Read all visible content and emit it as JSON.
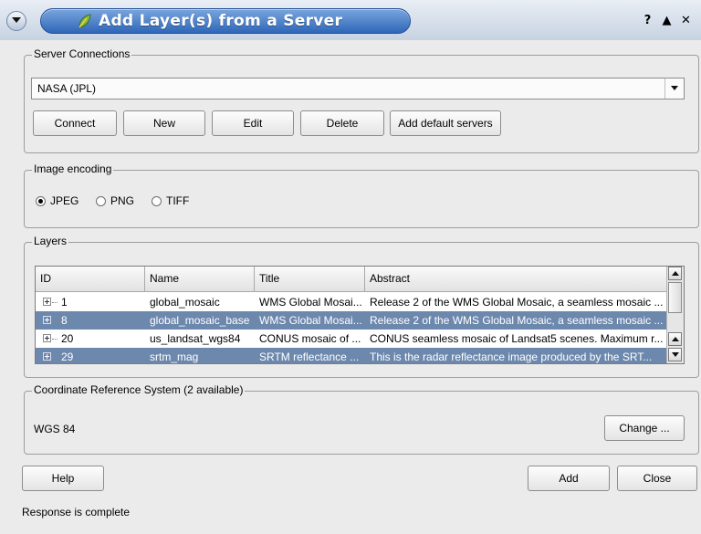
{
  "window": {
    "title": "Add Layer(s) from a Server",
    "controls": [
      "?",
      "▲",
      "✕"
    ]
  },
  "server_connections": {
    "group_title": "Server Connections",
    "selected_server": "NASA (JPL)",
    "buttons": {
      "connect": "Connect",
      "new": "New",
      "edit": "Edit",
      "delete": "Delete",
      "add_default": "Add default servers"
    }
  },
  "image_encoding": {
    "group_title": "Image encoding",
    "options": [
      {
        "label": "JPEG",
        "selected": true
      },
      {
        "label": "PNG",
        "selected": false
      },
      {
        "label": "TIFF",
        "selected": false
      }
    ]
  },
  "layers": {
    "group_title": "Layers",
    "columns": [
      "ID",
      "Name",
      "Title",
      "Abstract"
    ],
    "rows": [
      {
        "id": "1",
        "name": "global_mosaic",
        "title": "WMS Global Mosai...",
        "abstract": "Release 2 of the WMS Global Mosaic, a seamless mosaic ...",
        "selected": false
      },
      {
        "id": "8",
        "name": "global_mosaic_base",
        "title": "WMS Global Mosai...",
        "abstract": "Release 2 of the WMS Global Mosaic, a seamless mosaic ...",
        "selected": true
      },
      {
        "id": "20",
        "name": "us_landsat_wgs84",
        "title": "CONUS mosaic of ...",
        "abstract": "CONUS seamless mosaic of Landsat5 scenes. Maximum r...",
        "selected": false
      },
      {
        "id": "29",
        "name": "srtm_mag",
        "title": "SRTM reflectance ...",
        "abstract": "This is the radar reflectance image produced by the SRT...",
        "selected": true
      }
    ]
  },
  "crs": {
    "group_title": "Coordinate Reference System (2 available)",
    "value": "WGS 84",
    "change_label": "Change ..."
  },
  "footer": {
    "help_label": "Help",
    "add_label": "Add",
    "close_label": "Close",
    "status": "Response is complete"
  },
  "colors": {
    "title_accent": "#2f66b8",
    "selection": "#6d88ad",
    "dialog_bg": "#ebebeb"
  }
}
